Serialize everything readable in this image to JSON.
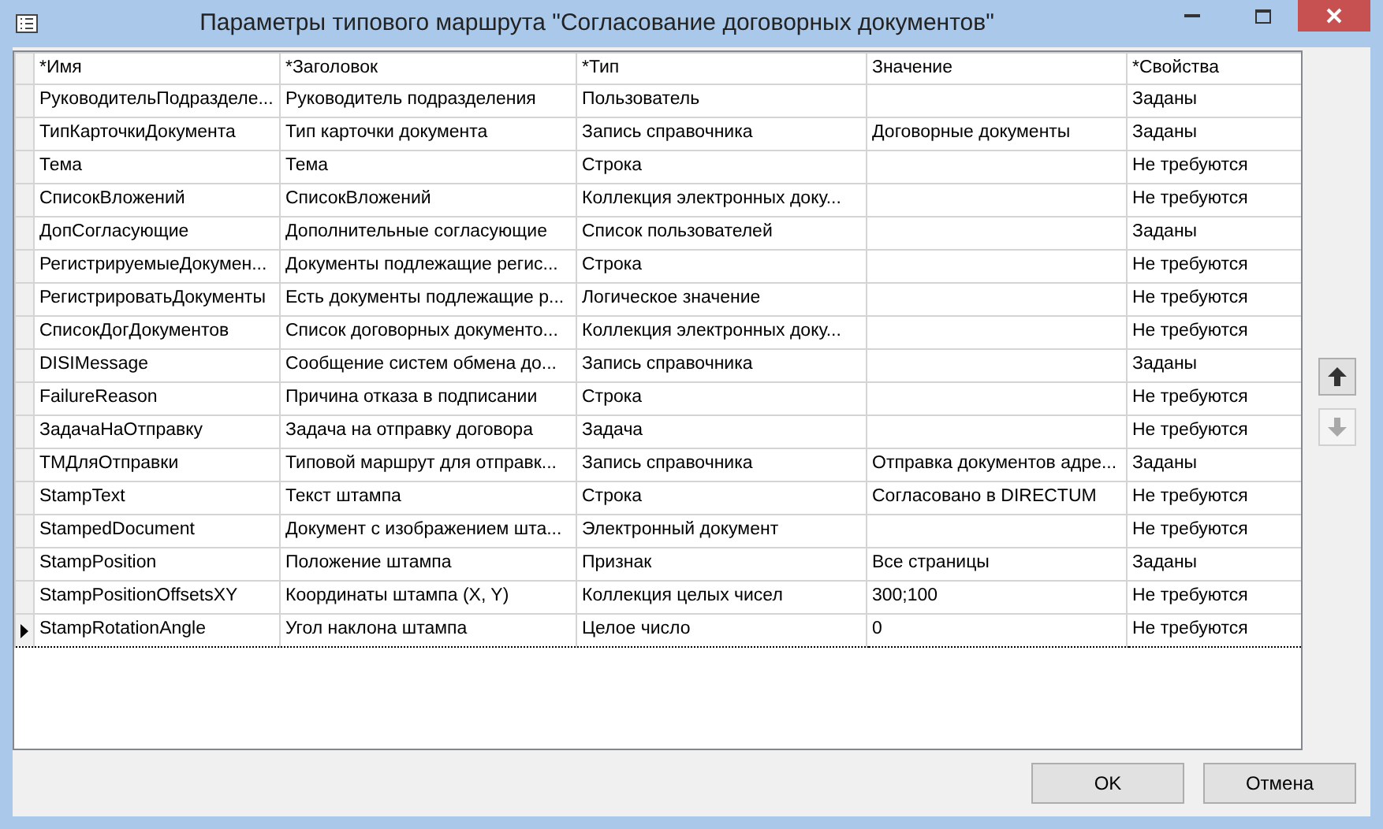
{
  "window": {
    "title": "Параметры типового маршрута \"Согласование договорных документов\""
  },
  "table": {
    "columns": [
      "*Имя",
      "*Заголовок",
      "*Тип",
      "Значение",
      "*Свойства"
    ],
    "rows": [
      {
        "cells": [
          "РуководительПодразделе...",
          "Руководитель подразделения",
          "Пользователь",
          "",
          "Заданы"
        ],
        "selected": false
      },
      {
        "cells": [
          "ТипКарточкиДокумента",
          "Тип карточки документа",
          "Запись справочника",
          "Договорные документы",
          "Заданы"
        ],
        "selected": false
      },
      {
        "cells": [
          "Тема",
          "Тема",
          "Строка",
          "",
          "Не требуются"
        ],
        "selected": false
      },
      {
        "cells": [
          "СписокВложений",
          "СписокВложений",
          "Коллекция электронных доку...",
          "",
          "Не требуются"
        ],
        "selected": false
      },
      {
        "cells": [
          "ДопСогласующие",
          "Дополнительные согласующие",
          "Список пользователей",
          "",
          "Заданы"
        ],
        "selected": false
      },
      {
        "cells": [
          "РегистрируемыеДокумен...",
          "Документы подлежащие регис...",
          "Строка",
          "",
          "Не требуются"
        ],
        "selected": false
      },
      {
        "cells": [
          "РегистрироватьДокументы",
          "Есть документы подлежащие р...",
          "Логическое значение",
          "",
          "Не требуются"
        ],
        "selected": false
      },
      {
        "cells": [
          "СписокДогДокументов",
          "Список договорных документо...",
          "Коллекция электронных доку...",
          "",
          "Не требуются"
        ],
        "selected": false
      },
      {
        "cells": [
          "DISIMessage",
          "Сообщение систем обмена до...",
          "Запись справочника",
          "",
          "Заданы"
        ],
        "selected": false
      },
      {
        "cells": [
          "FailureReason",
          "Причина отказа в подписании",
          "Строка",
          "",
          "Не требуются"
        ],
        "selected": false
      },
      {
        "cells": [
          "ЗадачаНаОтправку",
          "Задача на отправку договора",
          "Задача",
          "",
          "Не требуются"
        ],
        "selected": false
      },
      {
        "cells": [
          "ТМДляОтправки",
          "Типовой маршрут для отправк...",
          "Запись справочника",
          "Отправка документов адре...",
          "Заданы"
        ],
        "selected": false
      },
      {
        "cells": [
          "StampText",
          "Текст штампа",
          "Строка",
          "Согласовано в DIRECTUM",
          "Не требуются"
        ],
        "selected": false
      },
      {
        "cells": [
          "StampedDocument",
          "Документ с изображением шта...",
          "Электронный документ",
          "",
          "Не требуются"
        ],
        "selected": false
      },
      {
        "cells": [
          "StampPosition",
          "Положение штампа",
          "Признак",
          "Все страницы",
          "Заданы"
        ],
        "selected": false
      },
      {
        "cells": [
          "StampPositionOffsetsXY",
          "Координаты штампа (X, Y)",
          "Коллекция целых чисел",
          "300;100",
          "Не требуются"
        ],
        "selected": false
      },
      {
        "cells": [
          "StampRotationAngle",
          "Угол наклона штампа",
          "Целое число",
          "0",
          "Не требуются"
        ],
        "selected": true
      }
    ]
  },
  "move_buttons": [
    {
      "kind": "up",
      "disabled": false
    },
    {
      "kind": "down",
      "disabled": true
    }
  ],
  "buttons": [
    "OK",
    "Отмена"
  ]
}
